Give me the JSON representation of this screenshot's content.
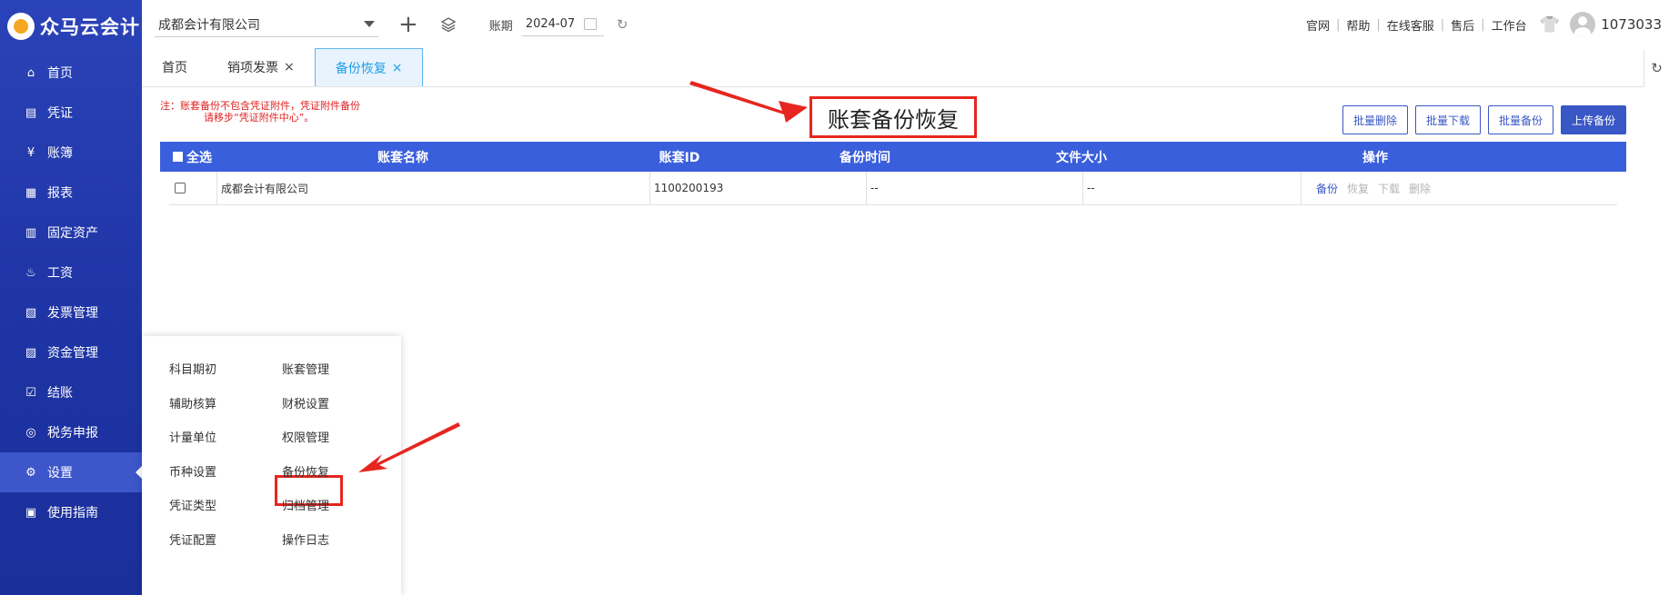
{
  "brand": {
    "name": "众马云会计"
  },
  "sidebar": {
    "items": [
      {
        "label": "首页",
        "icon": "home-icon",
        "glyph": "⌂"
      },
      {
        "label": "凭证",
        "icon": "voucher-icon",
        "glyph": "▤"
      },
      {
        "label": "账簿",
        "icon": "ledger-icon",
        "glyph": "¥"
      },
      {
        "label": "报表",
        "icon": "report-icon",
        "glyph": "▦"
      },
      {
        "label": "固定资产",
        "icon": "asset-icon",
        "glyph": "▥"
      },
      {
        "label": "工资",
        "icon": "salary-icon",
        "glyph": "♨"
      },
      {
        "label": "发票管理",
        "icon": "invoice-icon",
        "glyph": "▧"
      },
      {
        "label": "资金管理",
        "icon": "fund-icon",
        "glyph": "▨"
      },
      {
        "label": "结账",
        "icon": "close-account-icon",
        "glyph": "☑"
      },
      {
        "label": "税务申报",
        "icon": "tax-icon",
        "glyph": "◎"
      },
      {
        "label": "设置",
        "icon": "settings-icon",
        "glyph": "⚙"
      },
      {
        "label": "使用指南",
        "icon": "guide-icon",
        "glyph": "▣"
      }
    ],
    "active_index": 10
  },
  "topbar": {
    "company": "成都会计有限公司",
    "period_label": "账期",
    "period_value": "2024-07",
    "links": [
      "官网",
      "帮助",
      "在线客服",
      "售后",
      "工作台"
    ],
    "user_id": "1073033"
  },
  "tabs": [
    {
      "label": "首页",
      "closable": false,
      "active": false
    },
    {
      "label": "销项发票",
      "closable": true,
      "active": false
    },
    {
      "label": "备份恢复",
      "closable": true,
      "active": true
    }
  ],
  "page": {
    "note_line1": "注：账套备份不包含凭证附件，凭证附件备份",
    "note_line2": "请移步“凭证附件中心”。",
    "title": "账套备份恢复",
    "actions": [
      {
        "label": "批量删除",
        "primary": false
      },
      {
        "label": "批量下载",
        "primary": false
      },
      {
        "label": "批量备份",
        "primary": false
      },
      {
        "label": "上传备份",
        "primary": true
      }
    ]
  },
  "table": {
    "select_all": "全选",
    "columns": [
      "账套名称",
      "账套ID",
      "备份时间",
      "文件大小",
      "操作"
    ],
    "rows": [
      {
        "name": "成都会计有限公司",
        "id": "1100200193",
        "backup_time": "--",
        "file_size": "--",
        "ops": [
          {
            "label": "备份",
            "enabled": true
          },
          {
            "label": "恢复",
            "enabled": false
          },
          {
            "label": "下载",
            "enabled": false
          },
          {
            "label": "删除",
            "enabled": false
          }
        ]
      }
    ]
  },
  "flyout": {
    "left": [
      "科目期初",
      "辅助核算",
      "计量单位",
      "币种设置",
      "凭证类型",
      "凭证配置"
    ],
    "right": [
      "账套管理",
      "财税设置",
      "权限管理",
      "备份恢复",
      "归档管理",
      "操作日志"
    ],
    "highlighted": "备份恢复"
  },
  "colors": {
    "sidebar": "#2b43b8",
    "header_blue": "#3a5fdc",
    "annotation_red": "#e6261f",
    "tab_active": "#1e9ee8",
    "note_red": "#e02020"
  }
}
